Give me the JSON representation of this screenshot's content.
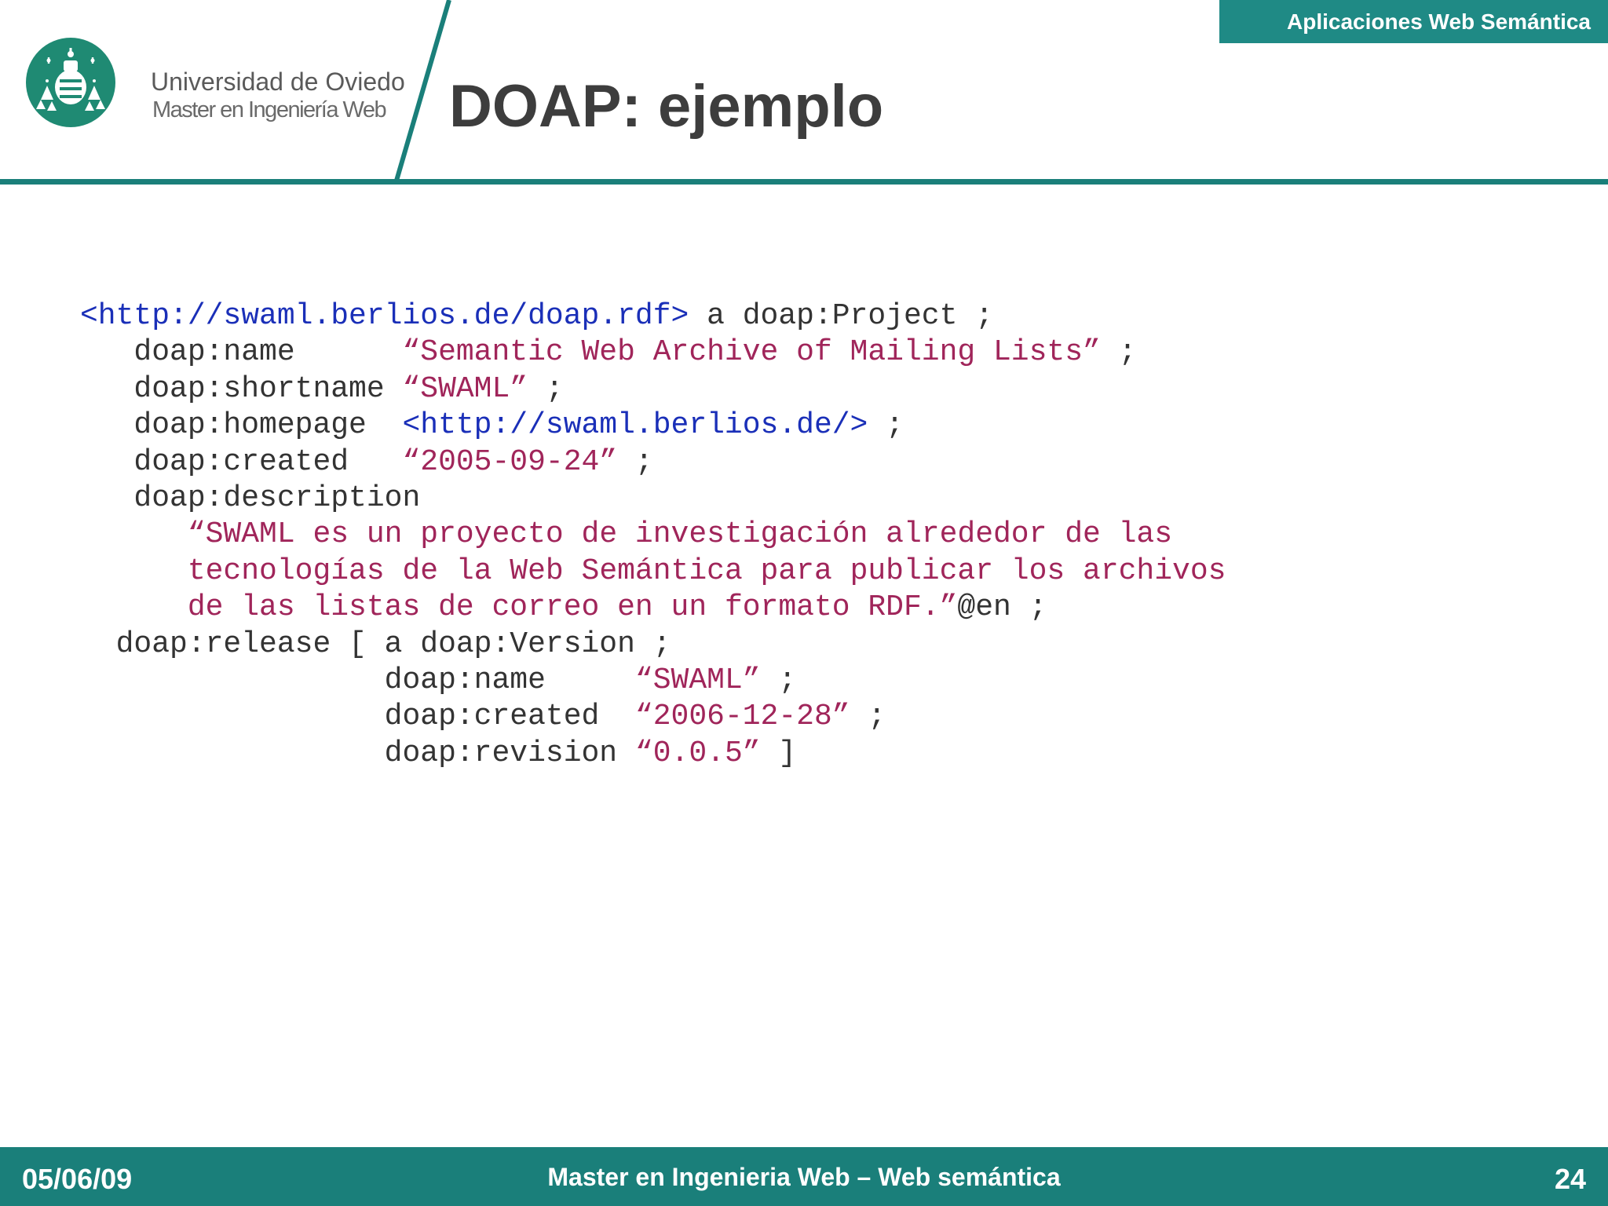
{
  "header": {
    "course_banner": "Aplicaciones Web Semántica",
    "university_name": "Universidad de Oviedo",
    "university_subtitle": "Master en Ingeniería Web",
    "slide_title": "DOAP: ejemplo"
  },
  "code": {
    "line1": {
      "uri": "<http://swaml.berlios.de/doap.rdf>",
      "rest": " a doap:Project ;"
    },
    "line2": {
      "prop": "   doap:name      ",
      "value": "“Semantic Web Archive of Mailing Lists”",
      "end": " ;"
    },
    "line3": {
      "prop": "   doap:shortname ",
      "value": "“SWAML”",
      "end": " ;"
    },
    "line4": {
      "prop": "   doap:homepage  ",
      "value": "<http://swaml.berlios.de/>",
      "end": " ;"
    },
    "line5": {
      "prop": "   doap:created   ",
      "value": "“2005-09-24”",
      "end": " ;"
    },
    "line6": {
      "prop": "   doap:description"
    },
    "line7": {
      "indent": "      ",
      "value": "“SWAML es un proyecto de investigación alrededor de las"
    },
    "line8": {
      "indent": "      ",
      "value": "tecnologías de la Web Semántica para publicar los archivos"
    },
    "line9": {
      "indent": "      ",
      "value": "de las listas de correo en un formato RDF.”",
      "end": "@en ;"
    },
    "line10": {
      "prop": "  doap:release [ a doap:Version ;"
    },
    "line11": {
      "prop": "                 doap:name     ",
      "value": "“SWAML”",
      "end": " ;"
    },
    "line12": {
      "prop": "                 doap:created  ",
      "value": "“2006-12-28”",
      "end": " ;"
    },
    "line13": {
      "prop": "                 doap:revision ",
      "value": "“0.0.5”",
      "end": " ]"
    }
  },
  "footer": {
    "date": "05/06/09",
    "course": "Master en Ingenieria Web – Web semántica",
    "page_number": "24"
  },
  "colors": {
    "teal": "#1a7f7a",
    "banner_teal": "#1f8a85",
    "uri_blue": "#1a2fb8",
    "string_red": "#a0255a",
    "title_gray": "#3d3d3d"
  }
}
